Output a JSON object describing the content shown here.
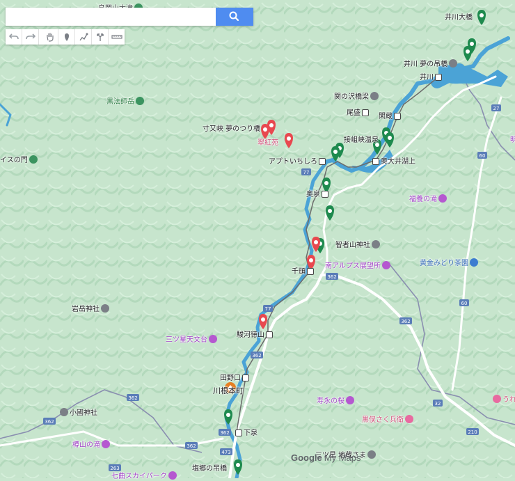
{
  "search": {
    "value": "",
    "placeholder": ""
  },
  "toolbar": {
    "tools": [
      "undo-icon",
      "redo-icon",
      "pan-hand-icon",
      "add-marker-icon",
      "draw-line-icon",
      "directions-icon",
      "measure-ruler-icon"
    ]
  },
  "colors": {
    "land": "#c9e6cf",
    "water": "#4ba3d6",
    "road_major": "#ffffff",
    "boundary": "#8a8fb0",
    "marker_green": "#1e8a4e",
    "marker_red": "#e8484f",
    "marker_orange": "#e67e22",
    "search_button": "#4f8cf0"
  },
  "places": {
    "kuromatsu": "鳥岡山大滝",
    "ikawa_ohashi": "井川大橋",
    "ikawa_yume": "井川 夢の吊橋",
    "ikawa": "井川",
    "sekinosawa": "関の沢橋梁",
    "kurohoshi": "黒法師岳",
    "osakari": "尾盛",
    "kanzo": "閑蔵",
    "sunmata": "寸又峡 夢のつり橋",
    "suikoen": "翠紅苑",
    "sessokyo": "接岨峡温泉",
    "aputoichishiro": "アプトいちしろ",
    "okuoi": "奥大井湖上",
    "isu_mon": "イスの門",
    "okuizumi": "奥泉",
    "fukuyo": "福養の滝",
    "chishayama": "智者山神社",
    "minami_alps": "南アルプス展望所",
    "kogane": "黄金みどり茶園",
    "senzu": "千頭",
    "iwatake": "岩岳神社",
    "mitsuboshi": "三ツ星天文台",
    "suruga_tokuyama": "駿河徳山",
    "tanoguchi": "田野口",
    "kawanehon": "川根本町",
    "sunaga": "寿永の桜",
    "ogura": "小國神社",
    "kuromata": "黒俣さく兵衛",
    "shimoizumi": "下泉",
    "hoko": "樽山の滝",
    "shiogo": "塩郷の吊橋",
    "nanakusa": "七曲スカイパーク",
    "sannomiya": "三ツ星 地蔵さま",
    "ue_shi": "うれ Shi",
    "mei": "明",
    "route_27": "27",
    "route_60a": "60",
    "route_60b": "60",
    "route_77a": "77",
    "route_77b": "77",
    "route_362a": "362",
    "route_362b": "362",
    "route_362c": "362",
    "route_362d": "362",
    "route_362e": "362",
    "route_362f": "362",
    "route_362g": "362",
    "route_32": "32",
    "route_210": "210",
    "route_263": "263",
    "route_473": "473"
  },
  "attribution": {
    "google": "Google",
    "mymaps": "My Maps"
  }
}
